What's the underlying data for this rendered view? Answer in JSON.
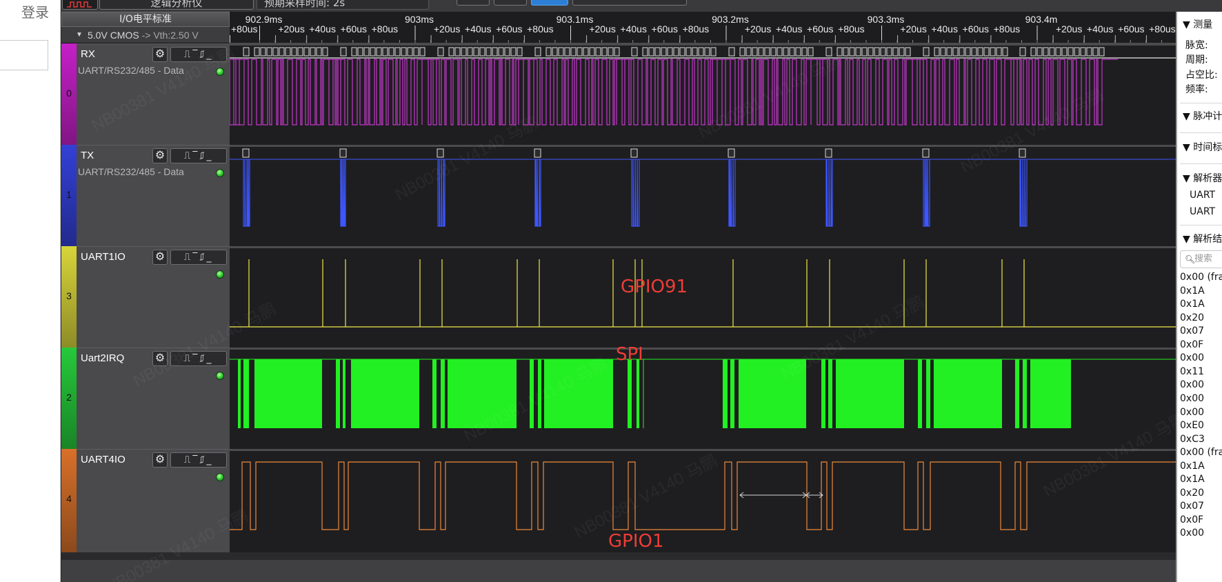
{
  "app": {
    "login_label": "登录"
  },
  "toolbar": {
    "title": "逻辑分析仪",
    "expected_sample_time": "预期采样时间: 2s"
  },
  "io_header": {
    "title": "I/O电平标准",
    "standard": "5.0V CMOS",
    "arrow": "->",
    "vth": "Vth:2.50 V"
  },
  "ruler": {
    "major": [
      "902.9ms",
      "903ms",
      "903.1ms",
      "903.2ms",
      "903.3ms",
      "903.4m"
    ],
    "first_minor": "+80us",
    "minor": [
      "+20us",
      "+40us",
      "+60us",
      "+80us"
    ]
  },
  "channels": [
    {
      "name": "RX",
      "decoder": "UART/RS232/485 - Data",
      "index": "0",
      "color": "#c520c8",
      "wave_color": "#e83cf0",
      "trig_icons": "⎍‾⎎_"
    },
    {
      "name": "TX",
      "decoder": "UART/RS232/485 - Data",
      "index": "1",
      "color": "#3340d6",
      "wave_color": "#3d56ff",
      "trig_icons": "⎍‾⎎_"
    },
    {
      "name": "UART1IO",
      "decoder": "",
      "index": "3",
      "color": "#d8d43a",
      "wave_color": "#f1e94a",
      "trig_icons": "⎍‾⎎_"
    },
    {
      "name": "Uart2IRQ",
      "decoder": "",
      "index": "2",
      "color": "#26c93a",
      "wave_color": "#22f022",
      "trig_icons": "⎍‾⎎_"
    },
    {
      "name": "UART4IO",
      "decoder": "",
      "index": "4",
      "color": "#d8702a",
      "wave_color": "#f08a3a",
      "trig_icons": "⎍‾⎎_"
    }
  ],
  "annotations": {
    "gpio91": "GPIO91",
    "spi": "SPI",
    "gpio1": "GPIO1"
  },
  "right_panel": {
    "measure": {
      "title": "测量",
      "items": [
        "脉宽:",
        "周期:",
        "占空比:",
        "频率:"
      ]
    },
    "pulse": "脉冲计",
    "timestamp": "时间标",
    "decoders": {
      "title": "解析器",
      "items": [
        "UART",
        "UART"
      ]
    },
    "results": {
      "title": "解析结"
    },
    "search_placeholder": "搜索",
    "hex_rows": [
      "0x00 (fra",
      "0x1A",
      "0x1A",
      "0x20",
      "0x07",
      "0x0F",
      "0x00",
      "0x11",
      "0x00",
      "0x00",
      "0x00",
      "0xE0",
      "0xC3",
      "0x00 (fra",
      "0x1A",
      "0x1A",
      "0x20",
      "0x07",
      "0x0F",
      "0x00"
    ]
  },
  "watermark": "NB00381 V4140 马鹏"
}
